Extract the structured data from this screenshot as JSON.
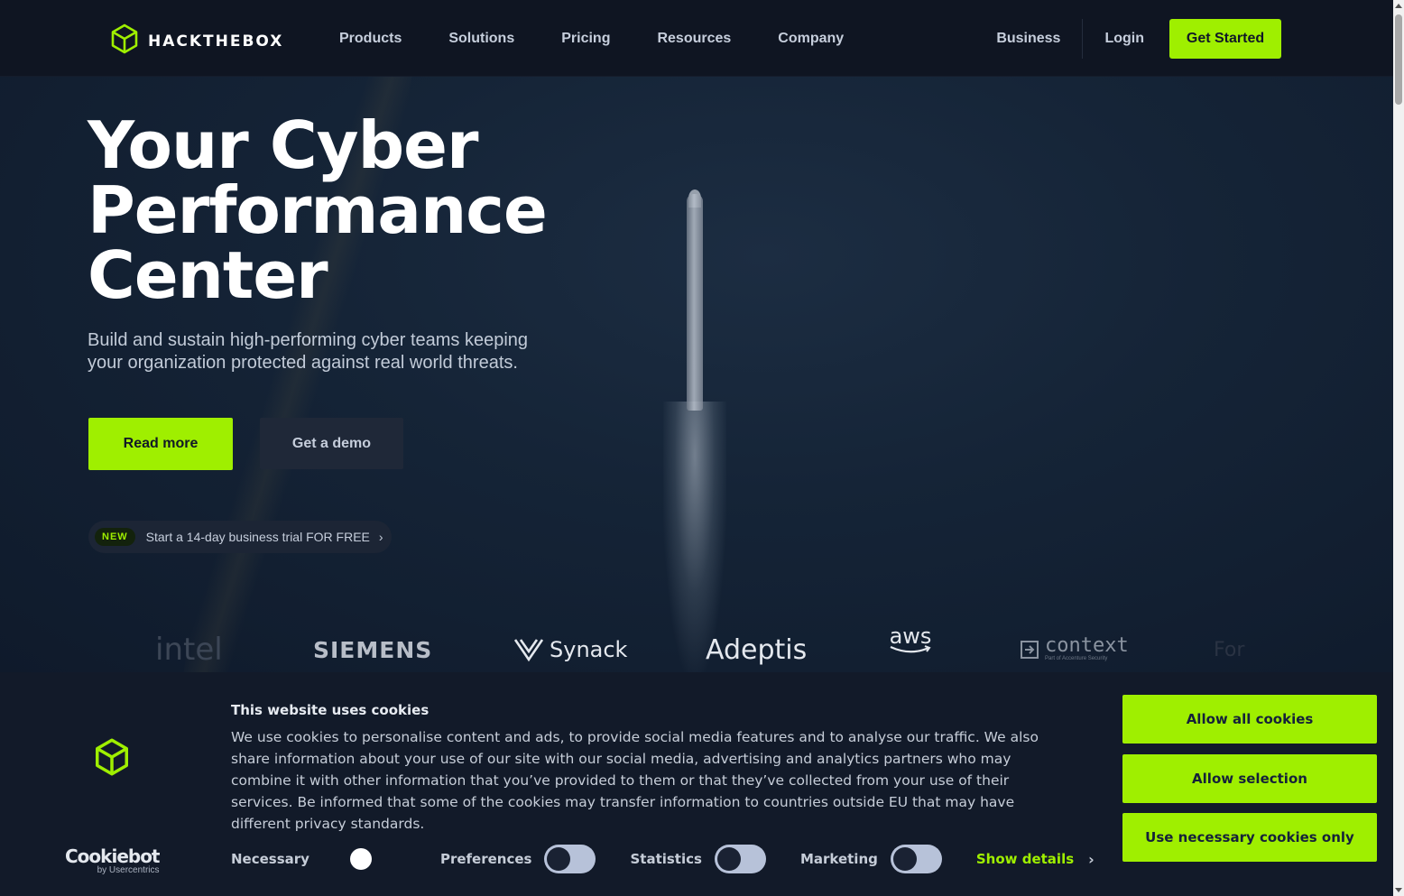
{
  "brand": {
    "name": "HACKTHEBOX",
    "accent": "#9fef00",
    "icon": "cube-logo-icon"
  },
  "nav": {
    "links": [
      "Products",
      "Solutions",
      "Pricing",
      "Resources",
      "Company"
    ],
    "business": "Business",
    "login": "Login",
    "cta": "Get Started"
  },
  "hero": {
    "title_lines": [
      "Your Cyber",
      "Performance",
      "Center"
    ],
    "subtitle_line1": "Build and sustain high-performing cyber teams keeping",
    "subtitle_line2": "your organization protected against real world threats.",
    "primary_button": "Read more",
    "secondary_button": "Get a demo",
    "trial_badge": "NEW",
    "trial_text": "Start a 14-day business trial FOR FREE"
  },
  "partners": [
    "intel",
    "SIEMENS",
    "Synack",
    "Adeptis",
    "aws",
    "context",
    "For"
  ],
  "partner_context_sub": "Part of Accenture Security",
  "cookie": {
    "title": "This website uses cookies",
    "body": "We use cookies to personalise content and ads, to provide social media features and to analyse our traffic. We also share information about your use of our site with our social media, advertising and analytics partners who may combine it with other information that you’ve provided to them or that they’ve collected from your use of their services. Be informed that some of the cookies may transfer information to countries outside EU that may have different privacy standards.",
    "toggles": [
      {
        "label": "Necessary",
        "state": "on-locked"
      },
      {
        "label": "Preferences",
        "state": "off"
      },
      {
        "label": "Statistics",
        "state": "off"
      },
      {
        "label": "Marketing",
        "state": "off"
      }
    ],
    "show_details": "Show details",
    "buttons": [
      "Allow all cookies",
      "Allow selection",
      "Use necessary cookies only"
    ],
    "provider": "Cookiebot",
    "provider_by": "by Usercentrics"
  }
}
